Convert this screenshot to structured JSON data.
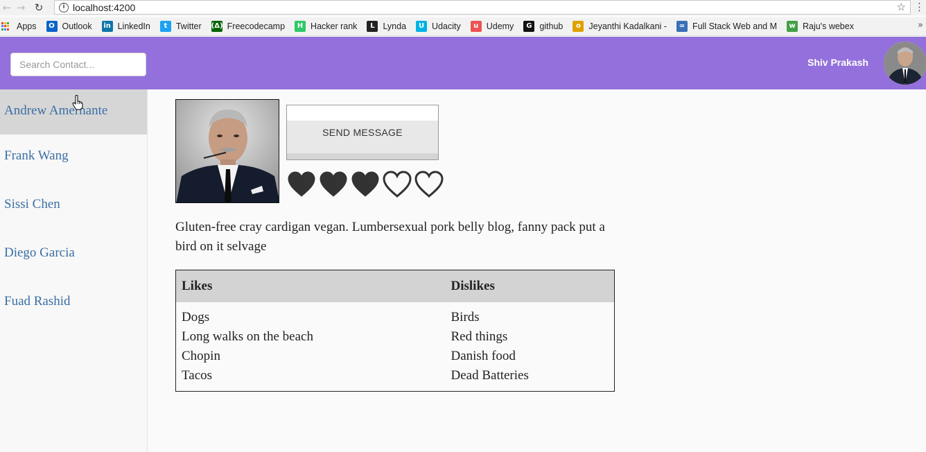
{
  "browser": {
    "url": "localhost:4200",
    "bookmarks": [
      {
        "label": "Apps",
        "icon": "apps-grid-icon"
      },
      {
        "label": "Outlook",
        "icon": "outlook-icon",
        "color": "#0a64c8"
      },
      {
        "label": "LinkedIn",
        "icon": "linkedin-icon",
        "color": "#0e76a8"
      },
      {
        "label": "Twitter",
        "icon": "twitter-icon",
        "color": "#1da1f2"
      },
      {
        "label": "Freecodecamp",
        "icon": "freecodecamp-icon",
        "color": "#006400"
      },
      {
        "label": "Hacker rank",
        "icon": "hackerrank-icon",
        "color": "#2ec866"
      },
      {
        "label": "Lynda",
        "icon": "lynda-icon",
        "color": "#222222"
      },
      {
        "label": "Udacity",
        "icon": "udacity-icon",
        "color": "#02b3e4"
      },
      {
        "label": "Udemy",
        "icon": "udemy-icon",
        "color": "#ec5252"
      },
      {
        "label": "github",
        "icon": "github-icon",
        "color": "#111111"
      },
      {
        "label": "Jeyanthi Kadalkani -",
        "icon": "bookmark-o-icon",
        "color": "#e0a000"
      },
      {
        "label": "Full Stack Web and M",
        "icon": "infinity-icon",
        "color": "#3b6fb6"
      },
      {
        "label": "Raju's webex",
        "icon": "webex-icon",
        "color": "#43a047"
      }
    ],
    "more_label": "»"
  },
  "header": {
    "search_placeholder": "Search Contact...",
    "user_name": "Shiv Prakash"
  },
  "contacts": [
    {
      "name": "Andrew Amernante",
      "active": true
    },
    {
      "name": "Frank Wang",
      "active": false
    },
    {
      "name": "Sissi Chen",
      "active": false
    },
    {
      "name": "Diego Garcia",
      "active": false
    },
    {
      "name": "Fuad Rashid",
      "active": false
    }
  ],
  "profile": {
    "send_message_label": "SEND MESSAGE",
    "rating": {
      "value": 3,
      "max": 5
    },
    "bio": "Gluten-free cray cardigan vegan. Lumbersexual pork belly blog, fanny pack put a bird on it selvage",
    "table": {
      "likes_header": "Likes",
      "dislikes_header": "Dislikes",
      "likes": [
        "Dogs",
        "Long walks on the beach",
        "Chopin",
        "Tacos"
      ],
      "dislikes": [
        "Birds",
        "Red things",
        "Danish food",
        "Dead Batteries"
      ]
    }
  },
  "colors": {
    "header_bg": "#9370db",
    "link": "#3a6ea5",
    "active_row": "#d6d6d6",
    "heart": "#333333"
  }
}
